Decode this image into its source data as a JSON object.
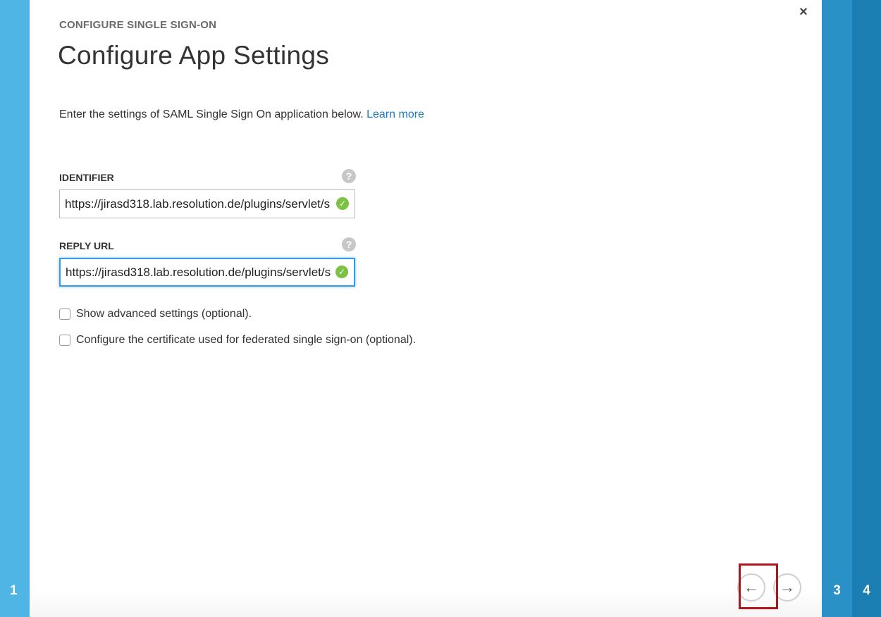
{
  "steps": {
    "left": "1",
    "right3": "3",
    "right4": "4"
  },
  "dialog": {
    "eyebrow": "CONFIGURE SINGLE SIGN-ON",
    "title": "Configure App Settings",
    "intro_text": "Enter the settings of SAML Single Sign On application below.",
    "learn_more": "Learn more",
    "close_glyph": "×",
    "help_glyph": "?",
    "valid_glyph": "✓",
    "fields": {
      "identifier": {
        "label": "IDENTIFIER",
        "value": "https://jirasd318.lab.resolution.de/plugins/servlet/s"
      },
      "reply_url": {
        "label": "REPLY URL",
        "value": "https://jirasd318.lab.resolution.de/plugins/servlet/s"
      }
    },
    "options": {
      "advanced": "Show advanced settings (optional).",
      "certificate": "Configure the certificate used for federated single sign-on (optional)."
    },
    "nav": {
      "back_glyph": "←",
      "next_glyph": "→"
    }
  },
  "colors": {
    "strip_left": "#4eb5e4",
    "strip_3": "#2a91c7",
    "strip_4": "#1b7fb4",
    "link": "#1a7dc4",
    "focus": "#3a9ae4",
    "valid": "#7cc242",
    "highlight": "#b0151b"
  }
}
